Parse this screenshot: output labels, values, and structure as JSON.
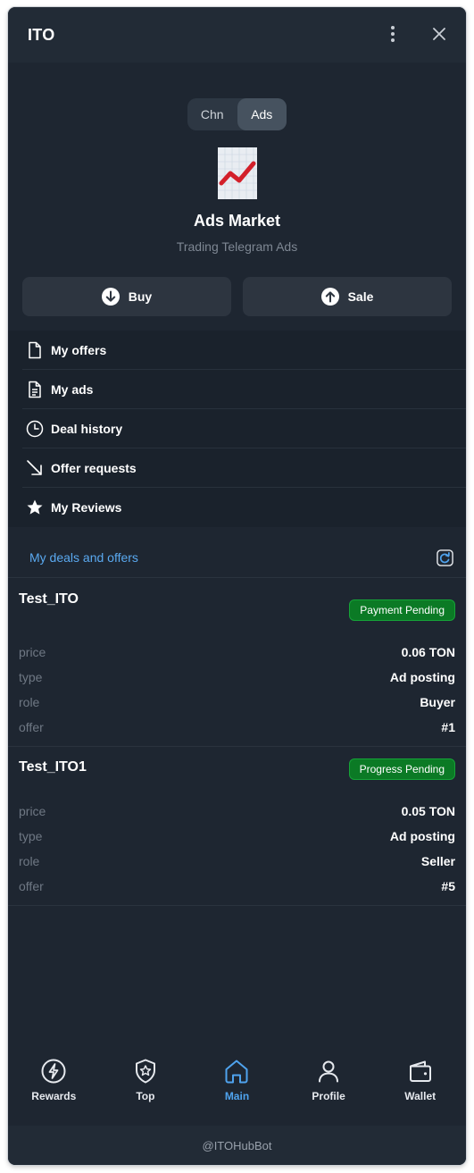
{
  "window": {
    "title": "ITO"
  },
  "segment": {
    "options": [
      "Chn",
      "Ads"
    ],
    "selected": "Ads"
  },
  "market": {
    "title": "Ads Market",
    "subtitle": "Trading Telegram Ads"
  },
  "actions": {
    "buy": "Buy",
    "sale": "Sale"
  },
  "menu": [
    {
      "label": "My offers",
      "icon": "document-icon"
    },
    {
      "label": "My ads",
      "icon": "document-text-icon"
    },
    {
      "label": "Deal history",
      "icon": "clock-icon"
    },
    {
      "label": "Offer requests",
      "icon": "arrow-down-right-icon"
    },
    {
      "label": "My Reviews",
      "icon": "star-icon"
    }
  ],
  "deals_section": {
    "title": "My deals and offers",
    "icon": "refresh-icon"
  },
  "deals": [
    {
      "name": "Test_ITO",
      "status": "Payment Pending",
      "rows": [
        {
          "key": "price",
          "value": "0.06 TON"
        },
        {
          "key": "type",
          "value": "Ad posting"
        },
        {
          "key": "role",
          "value": "Buyer"
        },
        {
          "key": "offer",
          "value": "#1"
        }
      ]
    },
    {
      "name": "Test_ITO1",
      "status": "Progress Pending",
      "rows": [
        {
          "key": "price",
          "value": "0.05 TON"
        },
        {
          "key": "type",
          "value": "Ad posting"
        },
        {
          "key": "role",
          "value": "Seller"
        },
        {
          "key": "offer",
          "value": "#5"
        }
      ]
    }
  ],
  "tabs": [
    {
      "label": "Rewards",
      "icon": "lightning-icon"
    },
    {
      "label": "Top",
      "icon": "star-badge-icon"
    },
    {
      "label": "Main",
      "icon": "home-icon",
      "active": true
    },
    {
      "label": "Profile",
      "icon": "user-icon"
    },
    {
      "label": "Wallet",
      "icon": "wallet-icon"
    }
  ],
  "footer": {
    "bot": "@ITOHubBot"
  },
  "colors": {
    "background": "#1e2631",
    "accent": "#4fa3ee",
    "badge": "#0b7a25"
  }
}
